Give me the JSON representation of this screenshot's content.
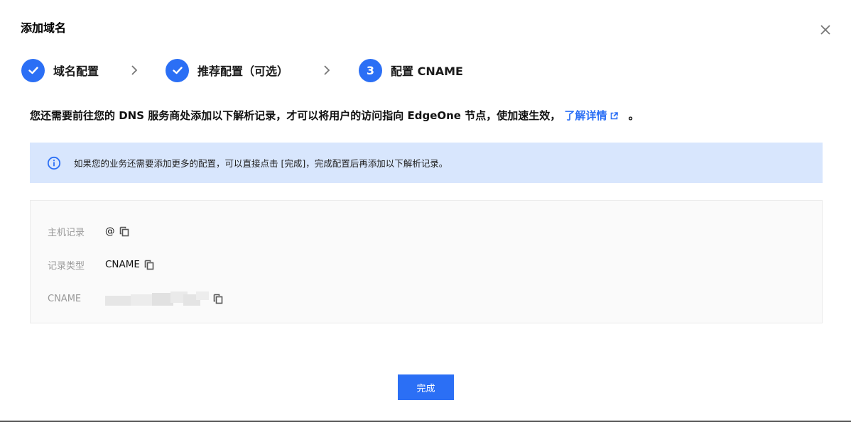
{
  "dialog": {
    "title": "添加域名",
    "close_icon": "close-icon"
  },
  "steps": [
    {
      "label": "域名配置",
      "state": "completed",
      "icon": "check-icon"
    },
    {
      "label": "推荐配置（可选）",
      "state": "completed",
      "icon": "check-icon"
    },
    {
      "label": "配置 CNAME",
      "state": "active",
      "number": "3"
    }
  ],
  "description": {
    "text": "您还需要前往您的 DNS 服务商处添加以下解析记录，才可以将用户的访问指向 EdgeOne 节点，使加速生效，",
    "link_text": "了解详情",
    "tail": "。"
  },
  "notice": {
    "icon": "info-icon",
    "text": "如果您的业务还需要添加更多的配置，可以直接点击 [完成]，完成配置后再添加以下解析记录。"
  },
  "records": [
    {
      "label": "主机记录",
      "value": "@"
    },
    {
      "label": "记录类型",
      "value": "CNAME"
    },
    {
      "label": "CNAME",
      "value": ""
    }
  ],
  "footer": {
    "done_label": "完成"
  },
  "colors": {
    "primary": "#2b6ff5",
    "notice_bg": "#d8e6fd",
    "records_bg": "#fafafa"
  }
}
